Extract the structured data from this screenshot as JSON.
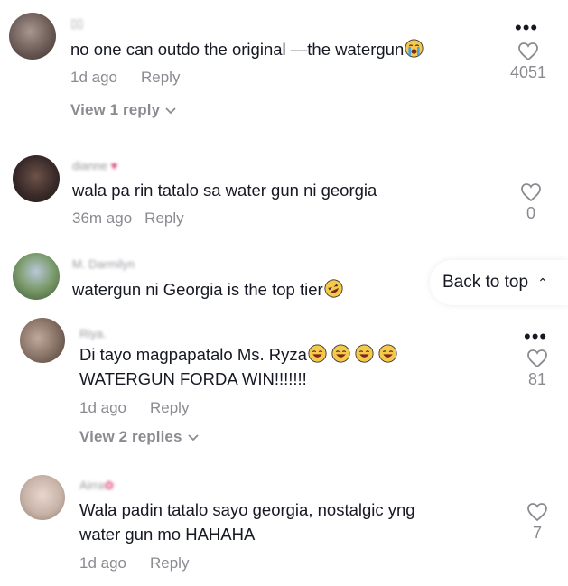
{
  "comments": [
    {
      "username": "▯▯",
      "text": "no one can outdo the original —the watergun",
      "time": "1d ago",
      "reply": "Reply",
      "likes": "4051",
      "view_replies": "View 1 reply",
      "avatar_color": "#6b5a55"
    },
    {
      "username": "dianne",
      "text": "wala pa rin tatalo sa water gun ni georgia",
      "time": "36m ago",
      "reply": "Reply",
      "likes": "0",
      "avatar_color": "#3a2b2a"
    },
    {
      "username": "M. Darmilyn",
      "text": "watergun ni Georgia is the top tier",
      "avatar_color": "#7a9a6a"
    },
    {
      "username": "Riya.",
      "text_line1": "Di tayo magpapatalo Ms. Ryza",
      "text_line2": "WATERGUN FORDA WIN!!!!!!!",
      "time": "1d ago",
      "reply": "Reply",
      "likes": "81",
      "view_replies": "View 2 replies",
      "avatar_color": "#8a7468"
    },
    {
      "username": "Airra",
      "text_line1": "Wala padin tatalo sayo georgia, nostalgic yng",
      "text_line2": "water gun mo HAHAHA",
      "time": "1d ago",
      "reply": "Reply",
      "likes": "7",
      "avatar_color": "#c8b3a8"
    }
  ],
  "back_to_top": "Back to top",
  "more_icon": "•••",
  "colors": {
    "text": "#161823",
    "muted": "#8a8b91",
    "accent": "#e0457a"
  }
}
